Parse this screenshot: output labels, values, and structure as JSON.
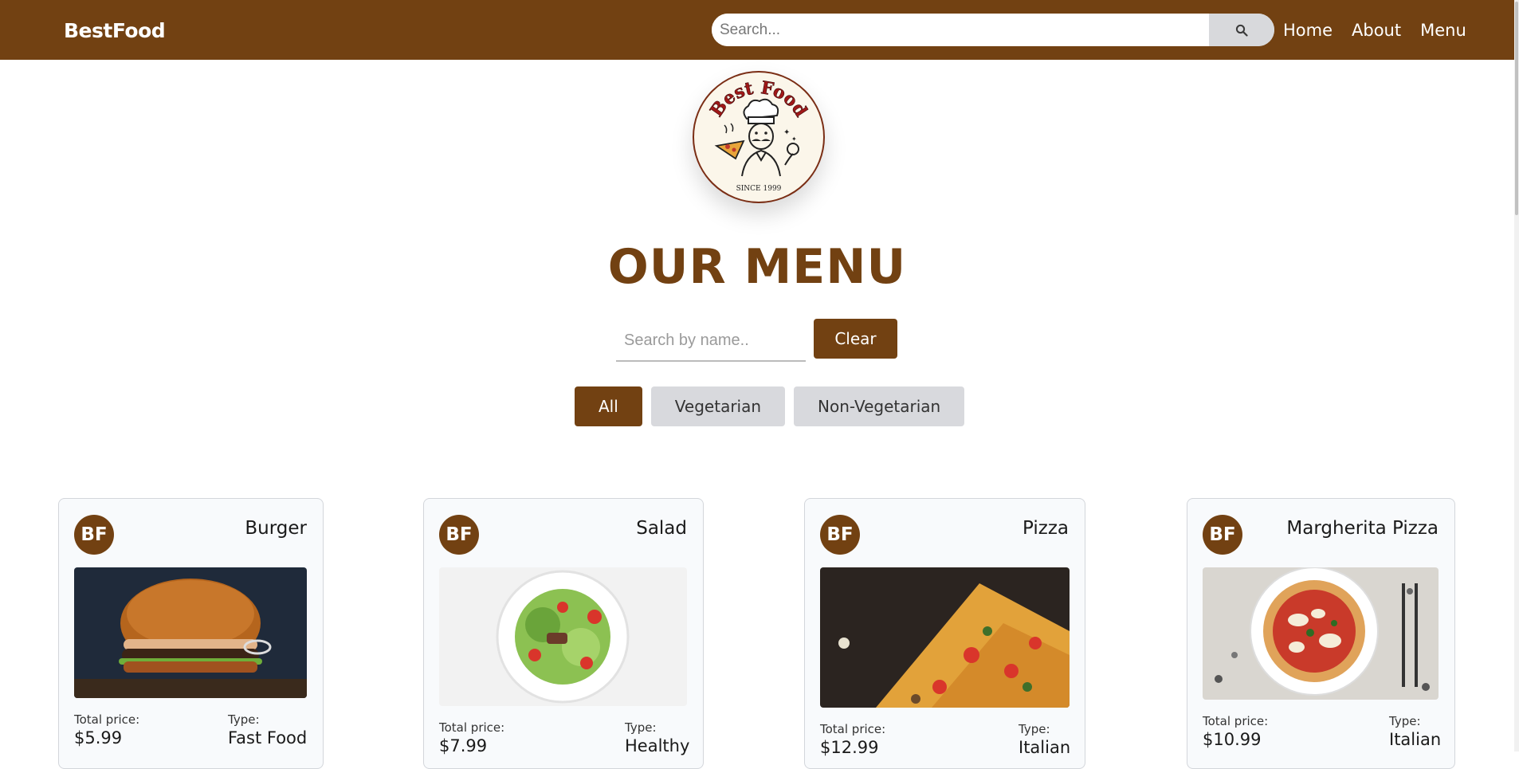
{
  "navbar": {
    "brand": "BestFood",
    "search_placeholder": "Search...",
    "links": [
      "Home",
      "About",
      "Menu"
    ]
  },
  "logo": {
    "title": "Best Food",
    "since": "SINCE 1999"
  },
  "page_title": "OUR MENU",
  "filter": {
    "placeholder": "Search by name..",
    "clear_label": "Clear",
    "tabs": [
      "All",
      "Vegetarian",
      "Non-Vegetarian"
    ],
    "active_tab": "All"
  },
  "items": [
    {
      "avatar": "BF",
      "name": "Burger",
      "price_label": "Total price:",
      "price": "$5.99",
      "type_label": "Type:",
      "type": "Fast Food"
    },
    {
      "avatar": "BF",
      "name": "Salad",
      "price_label": "Total price:",
      "price": "$7.99",
      "type_label": "Type:",
      "type": "Healthy"
    },
    {
      "avatar": "BF",
      "name": "Pizza",
      "price_label": "Total price:",
      "price": "$12.99",
      "type_label": "Type:",
      "type": "Italian"
    },
    {
      "avatar": "BF",
      "name": "Margherita Pizza",
      "price_label": "Total price:",
      "price": "$10.99",
      "type_label": "Type:",
      "type": "Italian"
    }
  ],
  "colors": {
    "brand": "#724112",
    "tab_inactive": "#d8d9dd",
    "card_bg": "#f8fafc"
  },
  "icons": {
    "search": "magnifier-icon"
  }
}
